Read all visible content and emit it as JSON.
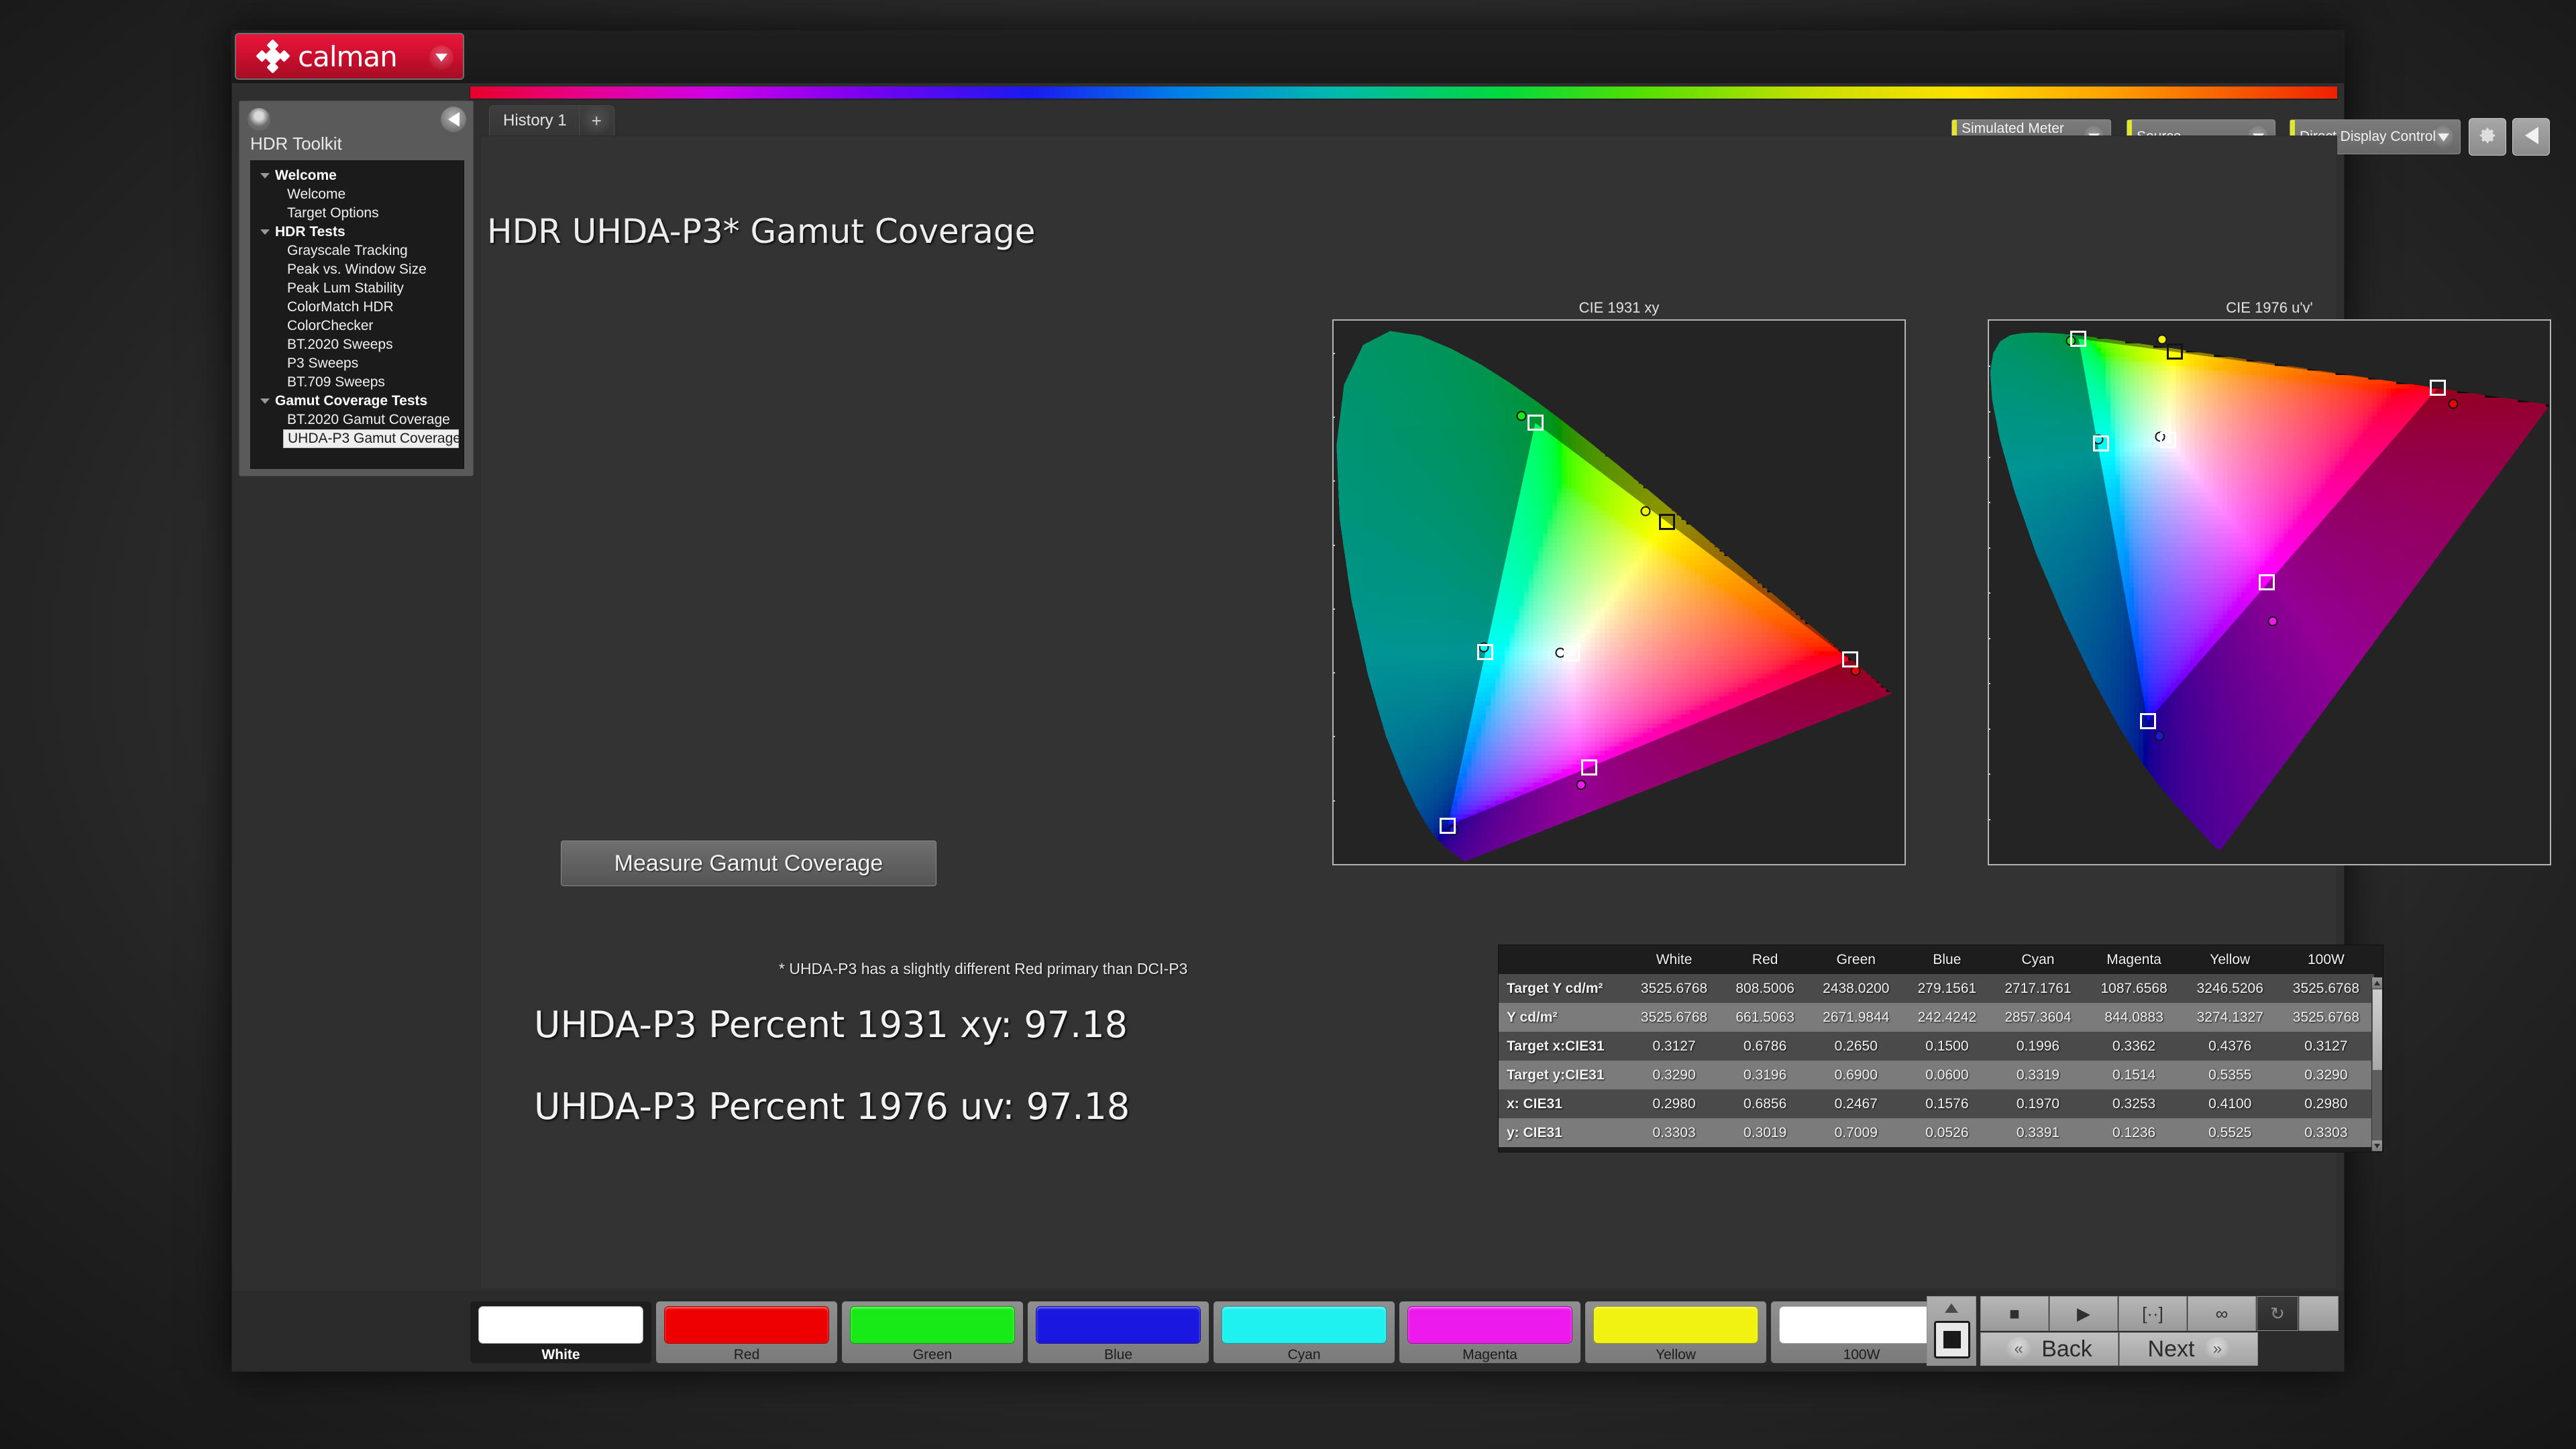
{
  "app": {
    "brand": "calman",
    "nav_title": "HDR Toolkit"
  },
  "tabs": [
    {
      "label": "History 1",
      "add_label": "+"
    }
  ],
  "selectors": [
    {
      "line1": "Simulated Meter",
      "line2": "Simulated"
    },
    {
      "line1": "Source",
      "line2": ""
    },
    {
      "line1": "Direct Display Control",
      "line2": ""
    }
  ],
  "sidebar": {
    "items": [
      {
        "label": "Welcome",
        "type": "group",
        "selected": false
      },
      {
        "label": "Welcome",
        "type": "leaf",
        "selected": false
      },
      {
        "label": "Target Options",
        "type": "leaf",
        "selected": false
      },
      {
        "label": "HDR Tests",
        "type": "group",
        "selected": false
      },
      {
        "label": "Grayscale Tracking",
        "type": "leaf",
        "selected": false
      },
      {
        "label": "Peak vs. Window Size",
        "type": "leaf",
        "selected": false
      },
      {
        "label": "Peak Lum Stability",
        "type": "leaf",
        "selected": false
      },
      {
        "label": "ColorMatch HDR",
        "type": "leaf",
        "selected": false
      },
      {
        "label": "ColorChecker",
        "type": "leaf",
        "selected": false
      },
      {
        "label": "BT.2020 Sweeps",
        "type": "leaf",
        "selected": false
      },
      {
        "label": "P3 Sweeps",
        "type": "leaf",
        "selected": false
      },
      {
        "label": "BT.709 Sweeps",
        "type": "leaf",
        "selected": false
      },
      {
        "label": "Gamut Coverage Tests",
        "type": "group",
        "selected": false
      },
      {
        "label": "BT.2020 Gamut Coverage",
        "type": "leaf",
        "selected": false
      },
      {
        "label": "UHDA-P3 Gamut Coverage",
        "type": "leaf",
        "selected": true
      }
    ]
  },
  "main": {
    "page_title": "HDR UHDA-P3* Gamut Coverage",
    "measure_button": "Measure Gamut Coverage",
    "footnote": "* UHDA-P3 has a slightly different Red primary than DCI-P3",
    "result_1931": "UHDA-P3 Percent 1931 xy: 97.18",
    "result_1976": "UHDA-P3 Percent 1976 uv: 97.18",
    "percent_1931": 97.18,
    "percent_1976": 97.18
  },
  "chart_data": [
    {
      "type": "scatter",
      "title": "CIE 1931 xy",
      "xlabel": "",
      "ylabel": "",
      "xlim": [
        0,
        0.75
      ],
      "ylim": [
        0,
        0.85
      ],
      "xticks": [
        0,
        0.1,
        0.2,
        0.3,
        0.4,
        0.5,
        0.6,
        0.7
      ],
      "yticks": [
        0.1,
        0.2,
        0.3,
        0.4,
        0.5,
        0.6,
        0.7,
        0.8
      ],
      "grid": false,
      "legend": "none",
      "series": [
        {
          "name": "Target (square markers)",
          "points": [
            {
              "label": "White",
              "x": 0.3127,
              "y": 0.329
            },
            {
              "label": "Red",
              "x": 0.6786,
              "y": 0.3196
            },
            {
              "label": "Green",
              "x": 0.265,
              "y": 0.69
            },
            {
              "label": "Blue",
              "x": 0.15,
              "y": 0.06
            },
            {
              "label": "Cyan",
              "x": 0.1996,
              "y": 0.3319
            },
            {
              "label": "Magenta",
              "x": 0.3362,
              "y": 0.1514
            },
            {
              "label": "Yellow",
              "x": 0.4376,
              "y": 0.5355
            },
            {
              "label": "100W",
              "x": 0.3127,
              "y": 0.329
            }
          ]
        },
        {
          "name": "Measured (circle markers)",
          "points": [
            {
              "label": "White",
              "x": 0.298,
              "y": 0.3303
            },
            {
              "label": "Red",
              "x": 0.6856,
              "y": 0.3019
            },
            {
              "label": "Green",
              "x": 0.2467,
              "y": 0.7009
            },
            {
              "label": "Blue",
              "x": 0.1576,
              "y": 0.0526
            },
            {
              "label": "Cyan",
              "x": 0.197,
              "y": 0.3391
            },
            {
              "label": "Magenta",
              "x": 0.3253,
              "y": 0.1236
            },
            {
              "label": "Yellow",
              "x": 0.41,
              "y": 0.5525
            },
            {
              "label": "100W",
              "x": 0.298,
              "y": 0.3303
            }
          ]
        }
      ]
    },
    {
      "type": "scatter",
      "title": "CIE 1976 u'v'",
      "xlabel": "",
      "ylabel": "",
      "xlim": [
        0,
        0.62
      ],
      "ylim": [
        0,
        0.6
      ],
      "xticks": [
        0,
        0.1,
        0.2,
        0.3,
        0.4,
        0.5
      ],
      "yticks": [
        0.05,
        0.1,
        0.15,
        0.2,
        0.25,
        0.3,
        0.35,
        0.4,
        0.45,
        0.5,
        0.55
      ],
      "grid": false,
      "legend": "none",
      "series": [
        {
          "name": "Target (square markers)",
          "points": [
            {
              "label": "White",
              "u": 0.1978,
              "v": 0.4683
            },
            {
              "label": "Red",
              "u": 0.4964,
              "v": 0.526
            },
            {
              "label": "Green",
              "u": 0.099,
              "v": 0.58
            },
            {
              "label": "Blue",
              "u": 0.1754,
              "v": 0.1579
            },
            {
              "label": "Cyan",
              "u": 0.1242,
              "v": 0.4647
            },
            {
              "label": "Magenta",
              "u": 0.3073,
              "v": 0.3113
            },
            {
              "label": "Yellow",
              "u": 0.2056,
              "v": 0.5659
            },
            {
              "label": "100W",
              "u": 0.1978,
              "v": 0.4683
            }
          ]
        },
        {
          "name": "Measured (circle markers)",
          "points": [
            {
              "label": "White",
              "u": 0.1893,
              "v": 0.4721
            },
            {
              "label": "Red",
              "u": 0.5131,
              "v": 0.5084
            },
            {
              "label": "Green",
              "u": 0.0904,
              "v": 0.5777
            },
            {
              "label": "Blue",
              "u": 0.1887,
              "v": 0.1417
            },
            {
              "label": "Cyan",
              "u": 0.1211,
              "v": 0.469
            },
            {
              "label": "Magenta",
              "u": 0.3136,
              "v": 0.2681
            },
            {
              "label": "Yellow",
              "u": 0.191,
              "v": 0.5791
            },
            {
              "label": "100W",
              "u": 0.1893,
              "v": 0.4721
            }
          ]
        }
      ]
    }
  ],
  "table": {
    "columns": [
      "White",
      "Red",
      "Green",
      "Blue",
      "Cyan",
      "Magenta",
      "Yellow",
      "100W"
    ],
    "rows": [
      {
        "label": "Target Y cd/m²",
        "values": [
          "3525.6768",
          "808.5006",
          "2438.0200",
          "279.1561",
          "2717.1761",
          "1087.6568",
          "3246.5206",
          "3525.6768"
        ]
      },
      {
        "label": "Y cd/m²",
        "values": [
          "3525.6768",
          "661.5063",
          "2671.9844",
          "242.4242",
          "2857.3604",
          "844.0883",
          "3274.1327",
          "3525.6768"
        ]
      },
      {
        "label": "Target x:CIE31",
        "values": [
          "0.3127",
          "0.6786",
          "0.2650",
          "0.1500",
          "0.1996",
          "0.3362",
          "0.4376",
          "0.3127"
        ]
      },
      {
        "label": "Target y:CIE31",
        "values": [
          "0.3290",
          "0.3196",
          "0.6900",
          "0.0600",
          "0.3319",
          "0.1514",
          "0.5355",
          "0.3290"
        ]
      },
      {
        "label": "x: CIE31",
        "values": [
          "0.2980",
          "0.6856",
          "0.2467",
          "0.1576",
          "0.1970",
          "0.3253",
          "0.4100",
          "0.2980"
        ]
      },
      {
        "label": "y: CIE31",
        "values": [
          "0.3303",
          "0.3019",
          "0.7009",
          "0.0526",
          "0.3391",
          "0.1236",
          "0.5525",
          "0.3303"
        ]
      }
    ]
  },
  "swatches": [
    {
      "label": "White",
      "color": "#ffffff",
      "active": true
    },
    {
      "label": "Red",
      "color": "#ee0000",
      "active": false
    },
    {
      "label": "Green",
      "color": "#18ea18",
      "active": false
    },
    {
      "label": "Blue",
      "color": "#1a17e0",
      "active": false
    },
    {
      "label": "Cyan",
      "color": "#1ff0f0",
      "active": false
    },
    {
      "label": "Magenta",
      "color": "#ec1aec",
      "active": false
    },
    {
      "label": "Yellow",
      "color": "#f2f210",
      "active": false
    },
    {
      "label": "100W",
      "color": "#ffffff",
      "active": false
    }
  ],
  "transport": {
    "stop": "■",
    "play": "▶",
    "bracket": "[··]",
    "loop": "∞",
    "refresh": "↻",
    "blank": "",
    "back": "Back",
    "next": "Next",
    "back_chev": "«",
    "next_chev": "»"
  },
  "colors": {
    "brand_red": "#cf0f2f",
    "accent_yellow": "#e3e52a",
    "panel": "#5a5a5a",
    "workspace": "#333333"
  }
}
